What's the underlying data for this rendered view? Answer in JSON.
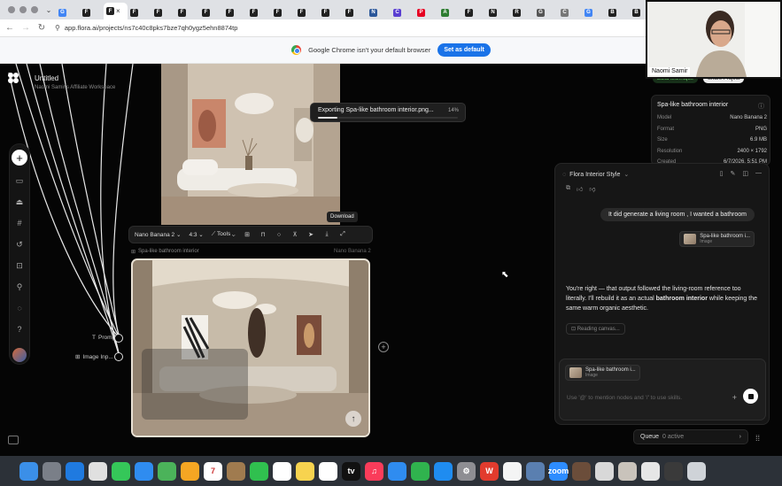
{
  "browser": {
    "tabs": [
      {
        "label": "G",
        "color": "#4285f4"
      },
      {
        "label": "F",
        "color": "#222222"
      },
      {
        "label": "F",
        "color": "#222222",
        "active": true
      },
      {
        "label": "F",
        "color": "#222222"
      },
      {
        "label": "F",
        "color": "#222222"
      },
      {
        "label": "F",
        "color": "#222222"
      },
      {
        "label": "F",
        "color": "#222222"
      },
      {
        "label": "F",
        "color": "#222222"
      },
      {
        "label": "F",
        "color": "#222222"
      },
      {
        "label": "F",
        "color": "#222222"
      },
      {
        "label": "F",
        "color": "#222222"
      },
      {
        "label": "F",
        "color": "#222222"
      },
      {
        "label": "F",
        "color": "#222222"
      },
      {
        "label": "N",
        "color": "#2b579a"
      },
      {
        "label": "C",
        "color": "#5a3fd1"
      },
      {
        "label": "P",
        "color": "#e60023"
      },
      {
        "label": "A",
        "color": "#2e7d32"
      },
      {
        "label": "F",
        "color": "#222222"
      },
      {
        "label": "N",
        "color": "#222222"
      },
      {
        "label": "R",
        "color": "#222222"
      },
      {
        "label": "G",
        "color": "#555555"
      },
      {
        "label": "C",
        "color": "#777777"
      },
      {
        "label": "G",
        "color": "#4285f4"
      },
      {
        "label": "B",
        "color": "#222222"
      },
      {
        "label": "B",
        "color": "#222222"
      },
      {
        "label": "P",
        "color": "#2e7d32"
      }
    ],
    "active_tab_close": "×",
    "url": "app.flora.ai/projects/ns7c40c8pks7bze7qh0ygz5ehn8874tp",
    "banner_text": "Google Chrome isn't your default browser",
    "banner_button": "Set as default"
  },
  "workspace": {
    "title": "Untitled",
    "subtitle": "Naomi Samir's Affiliate Workspace"
  },
  "canvas": {
    "export_text": "Exporting Spa-like bathroom interior.png...",
    "export_pct": "14%",
    "export_progress": 0.14,
    "tooltip": "Download",
    "toolbar": {
      "model": "Nano Banana 2",
      "ratio": "4:3",
      "tools": "Tools"
    },
    "node_title": "Spa-like bathroom interior",
    "node_model": "Nano Banana 2",
    "inputs": {
      "prompt": "Prompt",
      "image": "Image Inp..."
    }
  },
  "info_panel": {
    "top_left_button": "Build technique",
    "top_right_button": "Share Project",
    "title": "Spa-like bathroom interior",
    "rows": [
      {
        "label": "Model",
        "value": "Nano Banana 2"
      },
      {
        "label": "Format",
        "value": "PNG"
      },
      {
        "label": "Size",
        "value": "6.9 MB"
      },
      {
        "label": "Resolution",
        "value": "2400 × 1792"
      },
      {
        "label": "Created",
        "value": "6/7/2026, 5:51 PM"
      }
    ]
  },
  "chat": {
    "title": "Flora Interior Style",
    "user_message": "It did generate a living room , I wanted a bathroom",
    "user_attachment": {
      "title": "Spa-like bathroom i...",
      "sub": "Image"
    },
    "assistant_pre": "You're right — that output followed the living-room reference too literally. I'll rebuild it as an actual ",
    "assistant_bold": "bathroom interior",
    "assistant_post": " while keeping the same warm organic aesthetic.",
    "status": "Reading canvas...",
    "composer_attachment": {
      "title": "Spa-like bathroom i...",
      "sub": "Image"
    },
    "composer_placeholder": "Use '@' to mention nodes and '/' to use skills.",
    "queue_label": "Queue",
    "queue_status": "0 active"
  },
  "webcam": {
    "name": "Naomi Samir"
  },
  "dock": [
    {
      "name": "finder",
      "color": "#3b8fe8",
      "glyph": ""
    },
    {
      "name": "launchpad",
      "color": "#7a7f88",
      "glyph": ""
    },
    {
      "name": "safari",
      "color": "#1f7ae0",
      "glyph": ""
    },
    {
      "name": "chrome",
      "color": "#e0e0e0",
      "glyph": ""
    },
    {
      "name": "messages",
      "color": "#35c759",
      "glyph": ""
    },
    {
      "name": "mail",
      "color": "#2f8cf0",
      "glyph": ""
    },
    {
      "name": "maps",
      "color": "#4bb35a",
      "glyph": ""
    },
    {
      "name": "photos",
      "color": "#f5a623",
      "glyph": ""
    },
    {
      "name": "calendar",
      "color": "#ffffff",
      "glyph": "7"
    },
    {
      "name": "notes-brown",
      "color": "#a07b4f",
      "glyph": ""
    },
    {
      "name": "facetime",
      "color": "#30c04f",
      "glyph": ""
    },
    {
      "name": "reminders",
      "color": "#ffffff",
      "glyph": ""
    },
    {
      "name": "notes",
      "color": "#f7d34f",
      "glyph": ""
    },
    {
      "name": "freeform",
      "color": "#ffffff",
      "glyph": ""
    },
    {
      "name": "tv",
      "color": "#111111",
      "glyph": "tv"
    },
    {
      "name": "music",
      "color": "#fa3c5a",
      "glyph": "♫"
    },
    {
      "name": "keynote",
      "color": "#2f8cf0",
      "glyph": ""
    },
    {
      "name": "numbers",
      "color": "#30b34e",
      "glyph": ""
    },
    {
      "name": "app-store",
      "color": "#1f8cf0",
      "glyph": ""
    },
    {
      "name": "system-settings",
      "color": "#8e8e93",
      "glyph": "⚙"
    },
    {
      "name": "app-red",
      "color": "#e23b2e",
      "glyph": "W"
    },
    {
      "name": "capcut",
      "color": "#f4f4f4",
      "glyph": ""
    },
    {
      "name": "preview",
      "color": "#5a7fb0",
      "glyph": ""
    },
    {
      "name": "zoom",
      "color": "#2d8cff",
      "glyph": "zoom"
    },
    {
      "name": "doc-thumb-1",
      "color": "#6b4d3a",
      "glyph": ""
    },
    {
      "name": "doc-thumb-2",
      "color": "#d8d8d8",
      "glyph": ""
    },
    {
      "name": "doc-thumb-3",
      "color": "#c9c3bb",
      "glyph": ""
    },
    {
      "name": "doc-thumb-4",
      "color": "#e6e6e6",
      "glyph": ""
    },
    {
      "name": "doc-thumb-5",
      "color": "#3a3a3a",
      "glyph": ""
    },
    {
      "name": "trash",
      "color": "#cfd3d8",
      "glyph": ""
    }
  ]
}
